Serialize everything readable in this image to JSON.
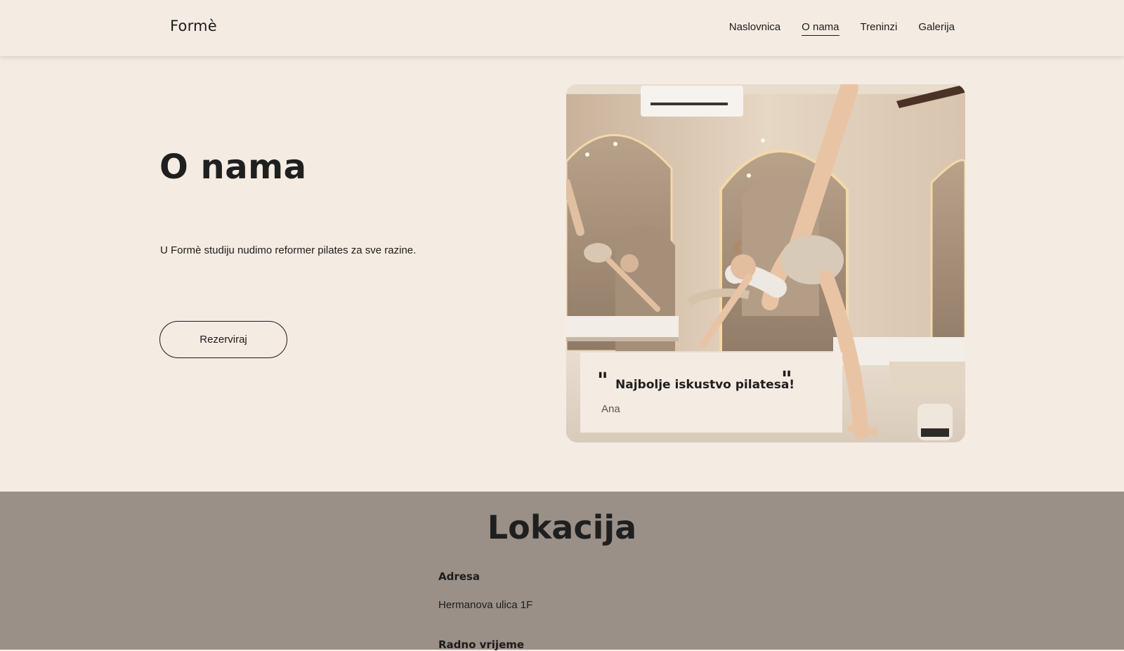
{
  "header": {
    "logo": "Formè",
    "nav": [
      {
        "label": "Naslovnica",
        "active": false
      },
      {
        "label": "O nama",
        "active": true
      },
      {
        "label": "Treninzi",
        "active": false
      },
      {
        "label": "Galerija",
        "active": false
      }
    ]
  },
  "hero": {
    "title": "O nama",
    "text": "U Formè studiju nudimo reformer pilates za sve razine.",
    "cta_label": "Rezerviraj",
    "image_description_icon": "pilates-studio-photo"
  },
  "testimonial": {
    "open_quote": "\"",
    "close_quote": "\"",
    "quote": "Najbolje iskustvo pilatesa!",
    "author": "Ana"
  },
  "location": {
    "title": "Lokacija",
    "address_label": "Adresa",
    "address_value": "Hermanova ulica 1F",
    "hours_label": "Radno vrijeme"
  },
  "colors": {
    "background": "#f4ebe2",
    "location_band": "#9a9088",
    "text": "#1c1c1c"
  }
}
